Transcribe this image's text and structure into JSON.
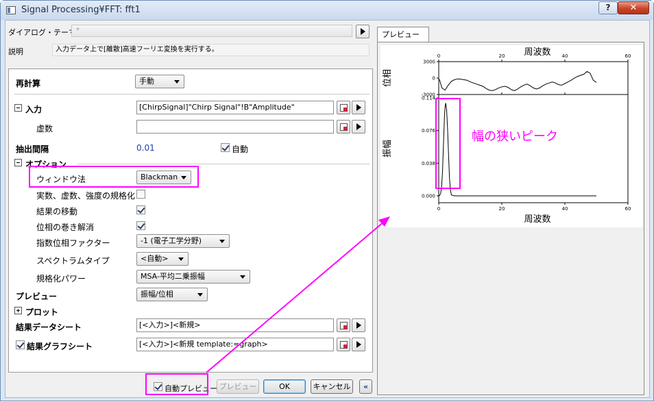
{
  "window": {
    "title": "Signal Processing¥FFT: fft1",
    "help_label": "?",
    "close_label": "✕"
  },
  "header": {
    "theme_label": "ダイアログ・テーマ(H)",
    "theme_value": "*",
    "desc_label": "説明",
    "desc_value": "入力データ上で[離散]高速フーリエ変換を実行する。"
  },
  "tree": {
    "recalc": {
      "label": "再計算",
      "value": "手動"
    },
    "input": {
      "label": "入力",
      "value": "[ChirpSignal]\"Chirp Signal\"!B\"Amplitude\""
    },
    "imag": {
      "label": "虚数",
      "value": ""
    },
    "interval": {
      "label": "抽出間隔",
      "value": "0.01",
      "auto_label": "自動",
      "auto_checked": true
    },
    "options": {
      "label": "オプション"
    },
    "window": {
      "label": "ウィンドウ法",
      "value": "Blackman"
    },
    "normalize": {
      "label": "実数、虚数、強度の規格化",
      "checked": false
    },
    "shift": {
      "label": "結果の移動",
      "checked": true
    },
    "unwrap": {
      "label": "位相の巻き解消",
      "checked": true
    },
    "factor": {
      "label": "指数位相ファクター",
      "value": "-1 (電子工学分野)"
    },
    "spectrum": {
      "label": "スペクトラムタイプ",
      "value": "<自動>"
    },
    "power": {
      "label": "規格化パワー",
      "value": "MSA-平均二乗振幅"
    },
    "preview": {
      "label": "プレビュー",
      "value": "振幅/位相"
    },
    "plot": {
      "label": "プロット"
    },
    "result_sheet": {
      "label": "結果データシート",
      "value": "[<入力>]<新規>"
    },
    "result_graph": {
      "label": "結果グラフシート",
      "value": "[<入力>]<新規 template:=graph>",
      "checked": true
    }
  },
  "footer": {
    "auto_preview_label": "自動プレビュー",
    "auto_preview_checked": true,
    "preview_btn": "プレビュー",
    "ok_btn": "OK",
    "cancel_btn": "キャンセル",
    "collapse_btn": "«"
  },
  "preview_tab": {
    "label": "プレビュー"
  },
  "annotation": {
    "text": "幅の狭いピーク",
    "color": "#ff00ff"
  },
  "chart_data": [
    {
      "type": "line",
      "title": "周波数",
      "xlabel": "周波数",
      "ylabel": "位相",
      "xlim": [
        0,
        60
      ],
      "ylim": [
        -3000,
        3000
      ],
      "xticks": [
        "0",
        "20",
        "40",
        "60"
      ],
      "yticks": [
        "3000",
        "0",
        "-3000"
      ],
      "x": [
        0.2,
        1,
        2,
        3,
        4,
        5,
        6,
        7,
        8,
        9,
        10,
        11,
        12,
        13,
        14,
        15,
        16,
        17,
        18,
        19,
        20,
        21,
        22,
        23,
        24,
        25,
        26,
        27,
        28,
        29,
        30,
        31,
        32,
        33,
        34,
        35,
        36,
        37,
        38,
        39,
        40,
        41,
        42,
        43,
        44,
        45,
        46,
        47,
        48,
        49,
        50
      ],
      "values": [
        -200,
        -1800,
        -2200,
        -1300,
        -600,
        -300,
        -150,
        -200,
        -300,
        -400,
        -700,
        -900,
        -1100,
        -1300,
        -1500,
        -1900,
        -2200,
        -2300,
        -2100,
        -1800,
        -1600,
        -1500,
        -1700,
        -2100,
        -2300,
        -2000,
        -1600,
        -1300,
        -1100,
        -1400,
        -1800,
        -2000,
        -1800,
        -1400,
        -1100,
        -900,
        -700,
        -900,
        -1200,
        -1300,
        -1000,
        -700,
        -400,
        0,
        300,
        500,
        700,
        1200,
        900,
        -400,
        -800
      ]
    },
    {
      "type": "line",
      "xlabel": "周波数",
      "ylabel": "振幅",
      "xlim": [
        0,
        60
      ],
      "ylim": [
        -0.008,
        0.118
      ],
      "xticks": [
        "0",
        "20",
        "40",
        "60"
      ],
      "yticks": [
        "0.114",
        "0.076",
        "0.038",
        "0.000"
      ],
      "x": [
        0,
        0.3,
        0.6,
        0.9,
        1.2,
        1.5,
        1.8,
        2.0,
        2.2,
        2.5,
        2.8,
        3.1,
        3.4,
        3.7,
        4.0,
        5,
        10,
        20,
        30,
        40,
        50
      ],
      "values": [
        0,
        0.0005,
        0.003,
        0.01,
        0.028,
        0.06,
        0.092,
        0.103,
        0.108,
        0.1,
        0.078,
        0.048,
        0.022,
        0.007,
        0.001,
        0,
        0,
        0,
        0,
        0,
        0
      ]
    }
  ]
}
